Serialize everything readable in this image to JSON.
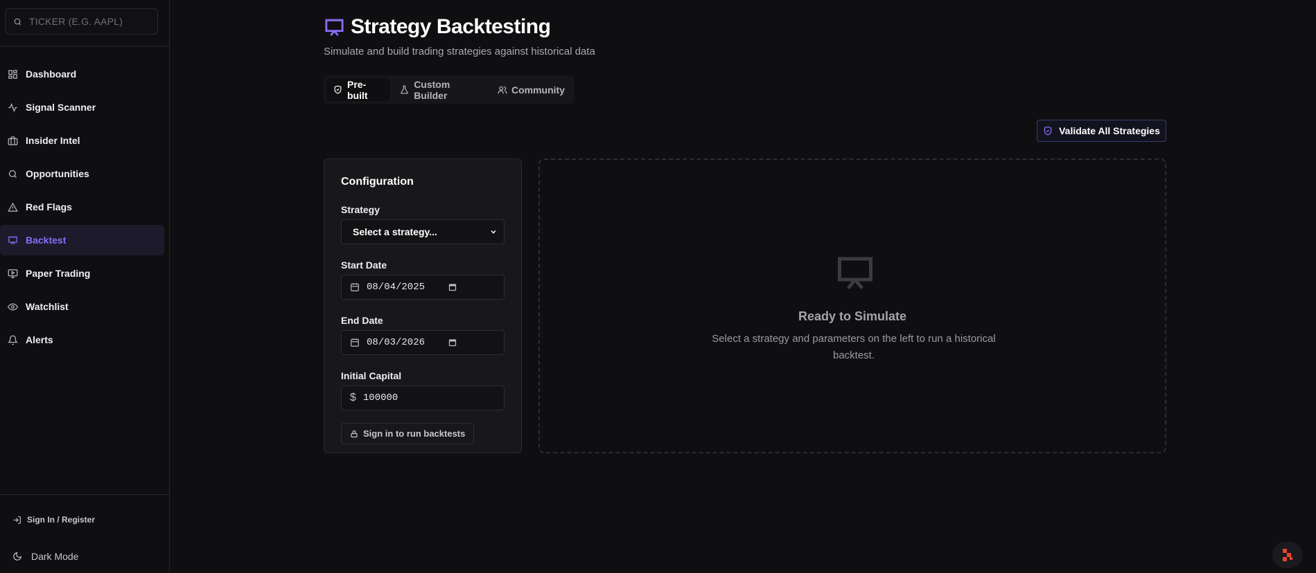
{
  "sidebar": {
    "search": {
      "placeholder": "TICKER (E.G. AAPL)"
    },
    "items": [
      {
        "label": "Dashboard",
        "icon": "grid-icon"
      },
      {
        "label": "Signal Scanner",
        "icon": "activity-icon"
      },
      {
        "label": "Insider Intel",
        "icon": "briefcase-icon"
      },
      {
        "label": "Opportunities",
        "icon": "search-icon"
      },
      {
        "label": "Red Flags",
        "icon": "warning-triangle-icon"
      },
      {
        "label": "Backtest",
        "icon": "presentation-icon",
        "active": true
      },
      {
        "label": "Paper Trading",
        "icon": "monitor-play-icon"
      },
      {
        "label": "Watchlist",
        "icon": "eye-icon"
      },
      {
        "label": "Alerts",
        "icon": "bell-icon"
      }
    ],
    "signin_label": "Sign In / Register",
    "darkmode_label": "Dark Mode"
  },
  "header": {
    "title": "Strategy Backtesting",
    "subtitle": "Simulate and build trading strategies against historical data"
  },
  "tabs": [
    {
      "label": "Pre-built",
      "icon": "shield-icon",
      "active": true
    },
    {
      "label": "Custom Builder",
      "icon": "flask-icon"
    },
    {
      "label": "Community",
      "icon": "users-icon"
    }
  ],
  "validate_button": "Validate All Strategies",
  "config": {
    "title": "Configuration",
    "strategy_label": "Strategy",
    "strategy_value": "Select a strategy...",
    "start_label": "Start Date",
    "start_value": "08/04/2025",
    "end_label": "End Date",
    "end_value": "08/03/2026",
    "capital_label": "Initial Capital",
    "capital_symbol": "$",
    "capital_value": "100000",
    "signin_button": "Sign in to run backtests"
  },
  "empty_state": {
    "title": "Ready to Simulate",
    "description": "Select a strategy and parameters on the left to run a historical backtest."
  },
  "colors": {
    "accent": "#8b6cf6",
    "background": "#0f0f11",
    "card": "#18181b",
    "widget_accent": "#e8452c"
  }
}
